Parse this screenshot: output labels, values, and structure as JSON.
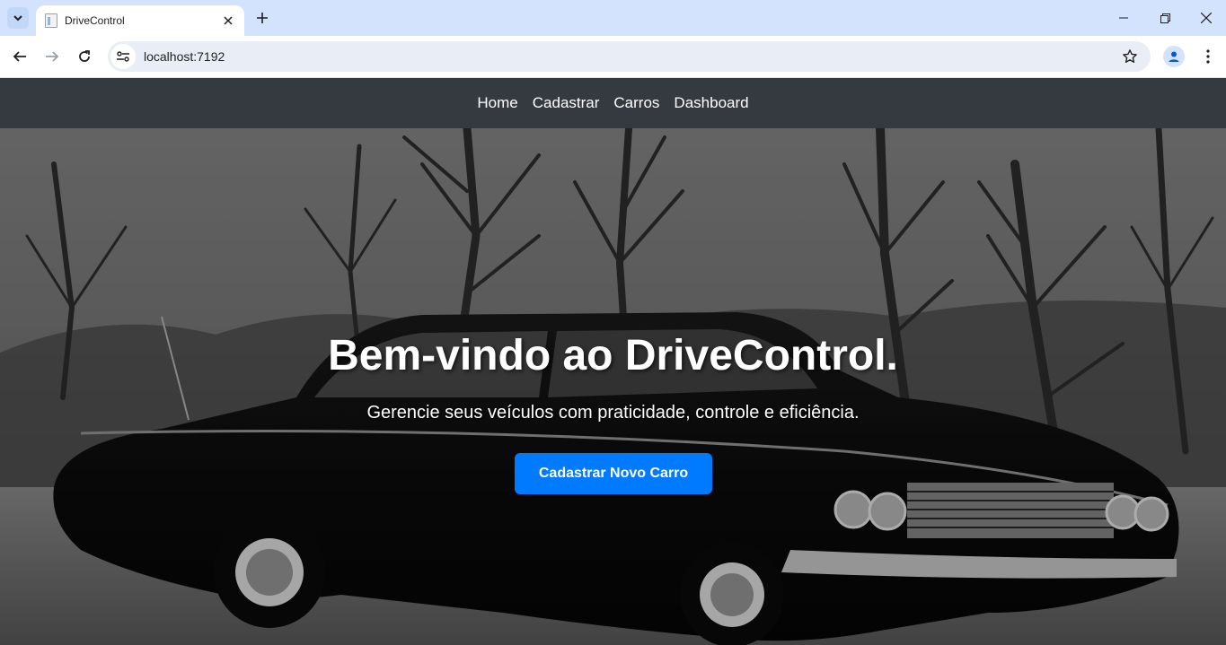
{
  "browser": {
    "tab_title": "DriveControl",
    "url": "localhost:7192"
  },
  "navbar": {
    "links": [
      "Home",
      "Cadastrar",
      "Carros",
      "Dashboard"
    ]
  },
  "hero": {
    "title": "Bem-vindo ao DriveControl.",
    "subtitle": "Gerencie seus veículos com praticidade, controle e eficiência.",
    "button_label": "Cadastrar Novo Carro",
    "button_color": "#007bff"
  },
  "colors": {
    "navbar_bg": "#343a40",
    "tabbar_bg": "#d3e3fd"
  }
}
